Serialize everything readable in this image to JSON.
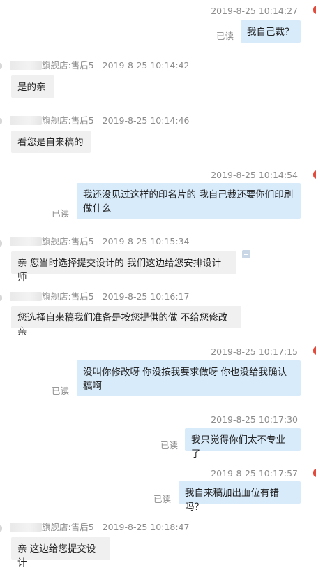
{
  "messages": [
    {
      "dir": "out",
      "time": "2019-8-25 10:14:27",
      "read": "已读",
      "text": "我自己裁？"
    },
    {
      "dir": "in",
      "sender": "旗舰店:售后5",
      "time": "2019-8-25 10:14:42",
      "text": "是的亲"
    },
    {
      "dir": "in",
      "sender": "旗舰店:售后5",
      "time": "2019-8-25 10:14:46",
      "text": "看您是自来稿的"
    },
    {
      "dir": "out",
      "time": "2019-8-25 10:14:54",
      "read": "已读",
      "line1": "我还没见过这样的印名片的  我自己裁还要你们印刷",
      "line2": "做什么"
    },
    {
      "dir": "in",
      "sender": "旗舰店:售后5",
      "time": "2019-8-25 10:15:34",
      "text": "亲 您当时选择提交设计的 我们这边给您安排设计师"
    },
    {
      "dir": "in",
      "sender": "旗舰店:售后5",
      "time": "2019-8-25 10:16:17",
      "text": "您选择自来稿我们准备是按您提供的做 不给您修改亲"
    },
    {
      "dir": "out",
      "time": "2019-8-25 10:17:15",
      "read": "已读",
      "line1": "没叫你修改呀 你没按我要求做呀  你也没给我确认",
      "line2": "稿啊"
    },
    {
      "dir": "out",
      "time": "2019-8-25 10:17:30",
      "read": "已读",
      "text": "我只觉得你们太不专业了"
    },
    {
      "dir": "out",
      "time": "2019-8-25 10:17:57",
      "read": "已读",
      "text": "我自来稿加出血位有错吗？"
    },
    {
      "dir": "in",
      "sender": "旗舰店:售后5",
      "time": "2019-8-25 10:18:47",
      "text": "亲 这边给您提交设计"
    }
  ],
  "colors": {
    "outgoing_bubble": "#d8ebfb",
    "incoming_bubble": "#f0f0f0",
    "meta_text": "#8c8c8c"
  }
}
